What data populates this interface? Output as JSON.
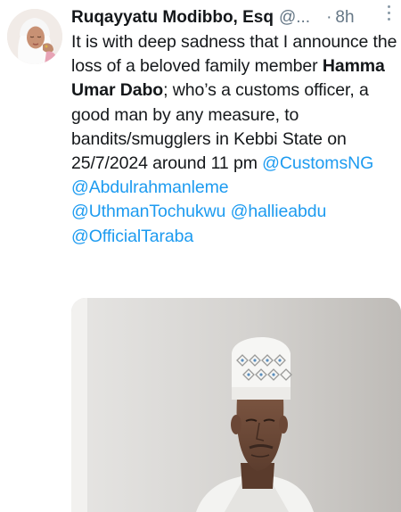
{
  "tweet": {
    "author": {
      "display_name": "Ruqayyatu Modibbo, Esq",
      "handle": "@...",
      "avatar_icon": "avatar-photo"
    },
    "dot": "·",
    "timestamp": "8h",
    "more_icon": "more-vertical-icon",
    "text": {
      "part1": "It is with deep sadness that I announce the loss of a beloved family member ",
      "bold_name": "Hamma Umar Dabo",
      "part2": "; who’s a customs officer, a good man by any measure, to bandits/smugglers in Kebbi State on 25/7/2024 around 11 pm ",
      "mention1": "@CustomsNG",
      "mention2": "@Abdulrahmanleme",
      "mention3": "@UthmanTochukwu",
      "mention4": "@hallieabdu",
      "mention5": "@OfficialTaraba"
    },
    "media": {
      "kind": "photo"
    }
  },
  "colors": {
    "link": "#1d9bf0",
    "secondary_text": "#657786",
    "primary_text": "#14171a"
  }
}
